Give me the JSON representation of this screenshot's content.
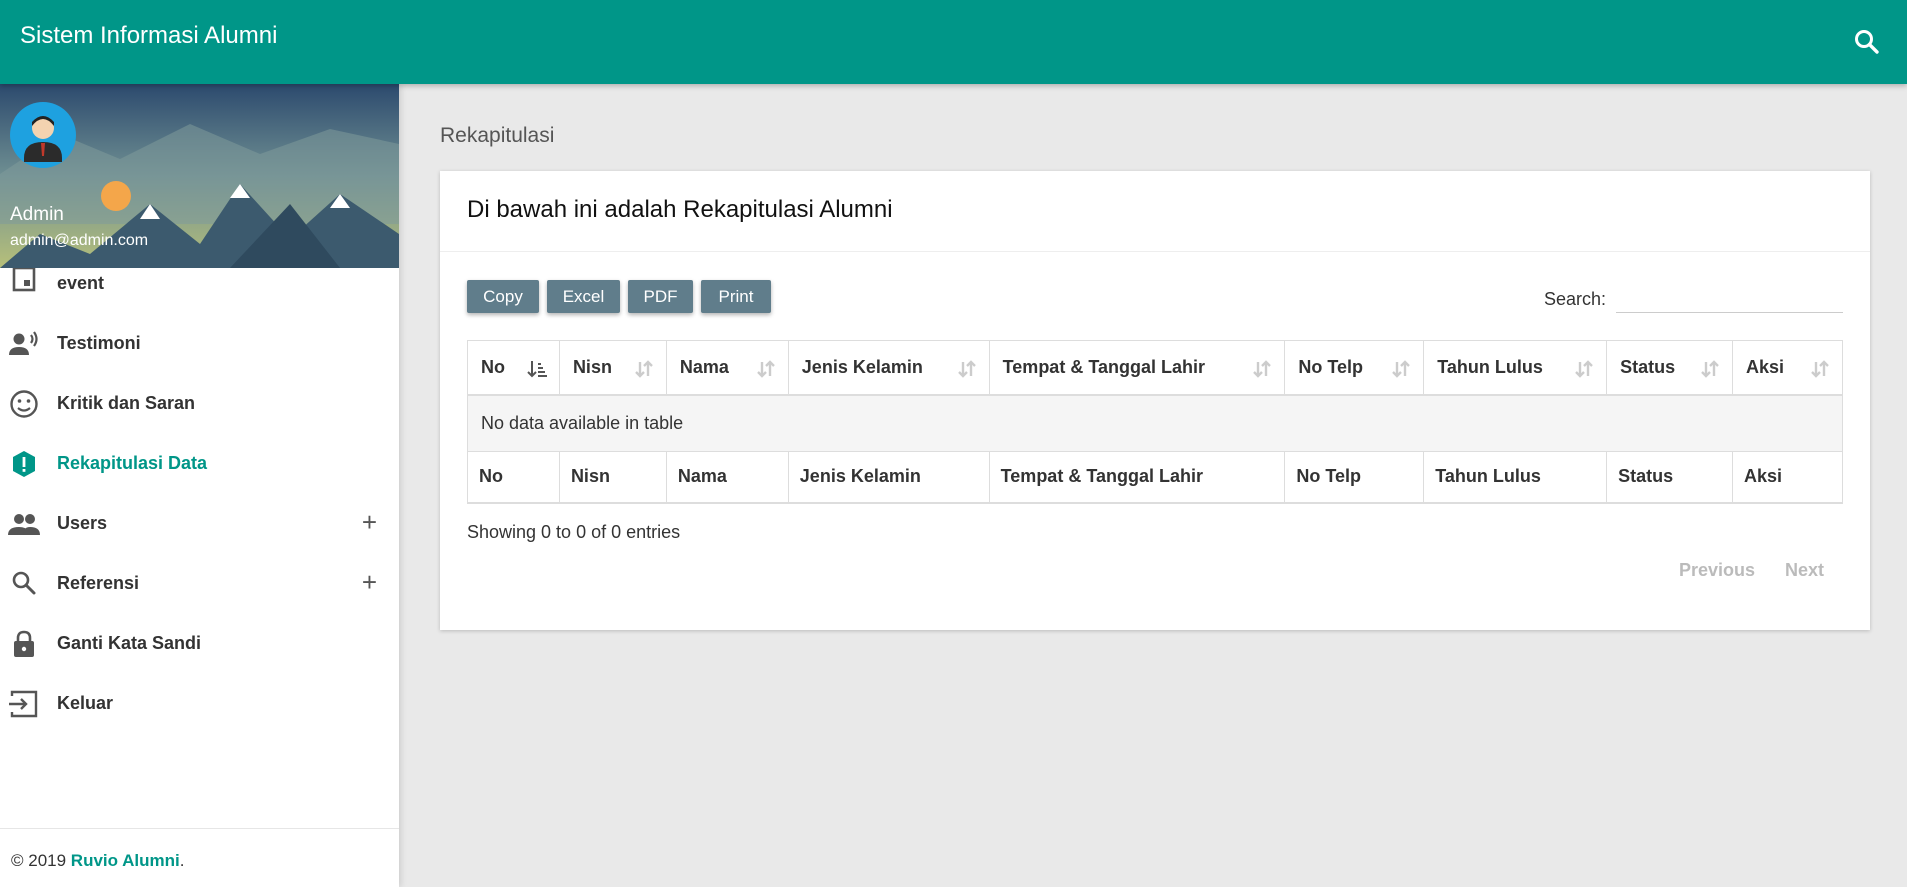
{
  "header": {
    "title": "Sistem Informasi Alumni",
    "search_icon": "search-icon"
  },
  "user": {
    "name": "Admin",
    "email": "admin@admin.com"
  },
  "menu": [
    {
      "label": "event",
      "icon": "event-icon"
    },
    {
      "label": "Testimoni",
      "icon": "record-voice-icon"
    },
    {
      "label": "Kritik dan Saran",
      "icon": "smiley-face-icon"
    },
    {
      "label": "Rekapitulasi Data",
      "icon": "alert-icon",
      "active": true
    },
    {
      "label": "Users",
      "icon": "people-icon",
      "expand": "+"
    },
    {
      "label": "Referensi",
      "icon": "search-icon",
      "expand": "+"
    },
    {
      "label": "Ganti Kata Sandi",
      "icon": "lock-icon"
    },
    {
      "label": "Keluar",
      "icon": "logout-icon"
    }
  ],
  "footer": {
    "year": "© 2019 ",
    "brand": "Ruvio Alumni",
    "suffix": "."
  },
  "page": {
    "heading": "Rekapitulasi"
  },
  "card": {
    "title": "Di bawah ini adalah Rekapitulasi Alumni",
    "buttons": [
      "Copy",
      "Excel",
      "PDF",
      "Print"
    ],
    "search_label": "Search:",
    "search_value": ""
  },
  "table": {
    "columns": [
      "No",
      "Nisn",
      "Nama",
      "Jenis Kelamin",
      "Tempat & Tanggal Lahir",
      "No Telp",
      "Tahun Lulus",
      "Status",
      "Aksi"
    ],
    "empty_message": "No data available in table",
    "info": "Showing 0 to 0 of 0 entries",
    "previous": "Previous",
    "next": "Next"
  },
  "colors": {
    "primary": "#009688",
    "button": "#607d8b",
    "background": "#e9e9e9"
  }
}
